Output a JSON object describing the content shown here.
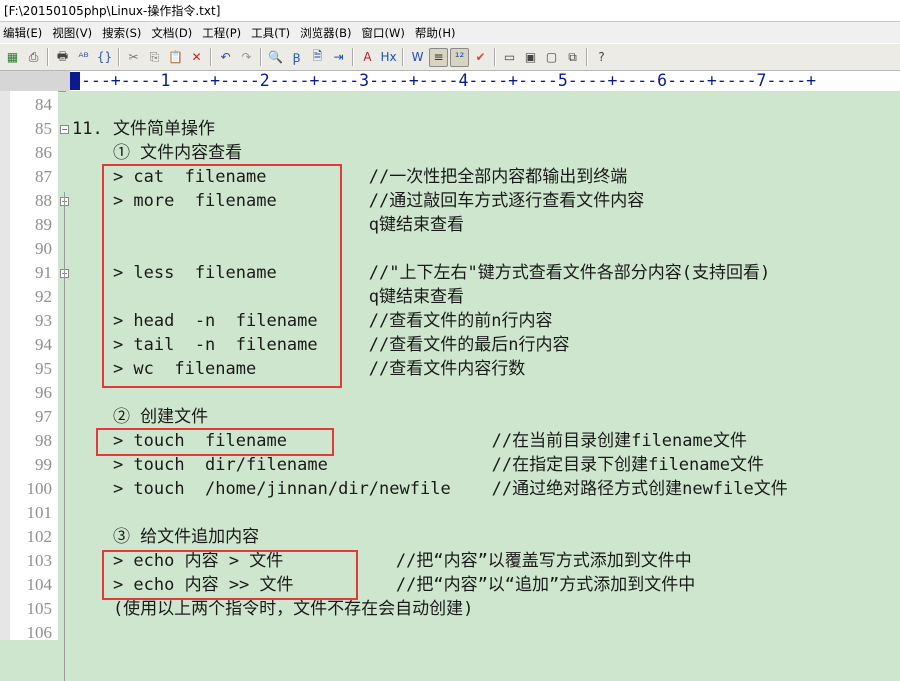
{
  "window": {
    "title": "[F:\\20150105php\\Linux-操作指令.txt]"
  },
  "menu": [
    "编辑(E)",
    "视图(V)",
    "搜索(S)",
    "文档(D)",
    "工程(P)",
    "工具(T)",
    "浏览器(B)",
    "窗口(W)",
    "帮助(H)"
  ],
  "toolbar": {
    "icons": [
      "new-file-icon",
      "print-icon",
      "print-preview-icon",
      "spell-check-icon",
      "bracket-match-icon",
      "cut-icon",
      "copy-icon",
      "paste-icon",
      "delete-icon",
      "undo-icon",
      "redo-icon",
      "find-icon",
      "replace-icon",
      "find-in-files-icon",
      "goto-icon",
      "font-icon",
      "hex-icon",
      "word-wrap-icon",
      "line-number-icon",
      "ruler-toggle-icon",
      "check-icon",
      "view-icon",
      "tile-icon",
      "cascade-icon",
      "window-list-icon",
      "help-pointer-icon"
    ],
    "glyphs": [
      "▦",
      "⎙",
      "🖶",
      "ᴬᴮ",
      "{}",
      "✂",
      "⎘",
      "📋",
      "✕",
      "↶",
      "↷",
      "🔍",
      "Ꞵ",
      "🗎",
      "⇥",
      "A",
      "Hx",
      "W",
      "≡",
      "¹²",
      "✔",
      "▭",
      "▣",
      "▢",
      "⧉",
      "?"
    ]
  },
  "ruler": {
    "marks": "---+----1----+----2----+----3----+----4----+----5----+----6----+----7----+"
  },
  "editor": {
    "lines": [
      {
        "n": "84",
        "text": ""
      },
      {
        "n": "85",
        "text": "11. 文件简单操作"
      },
      {
        "n": "86",
        "text": "    ① 文件内容查看"
      },
      {
        "n": "87",
        "text": "    > cat  filename          //一次性把全部内容都输出到终端"
      },
      {
        "n": "88",
        "text": "    > more  filename         //通过敲回车方式逐行查看文件内容"
      },
      {
        "n": "89",
        "text": "                             q键结束查看"
      },
      {
        "n": "90",
        "text": ""
      },
      {
        "n": "91",
        "text": "    > less  filename         //\"上下左右\"键方式查看文件各部分内容(支持回看)"
      },
      {
        "n": "92",
        "text": "                             q键结束查看"
      },
      {
        "n": "93",
        "text": "    > head  -n  filename     //查看文件的前n行内容"
      },
      {
        "n": "94",
        "text": "    > tail  -n  filename     //查看文件的最后n行内容"
      },
      {
        "n": "95",
        "text": "    > wc  filename           //查看文件内容行数"
      },
      {
        "n": "96",
        "text": ""
      },
      {
        "n": "97",
        "text": "    ② 创建文件"
      },
      {
        "n": "98",
        "text": "    > touch  filename                    //在当前目录创建filename文件"
      },
      {
        "n": "99",
        "text": "    > touch  dir/filename                //在指定目录下创建filename文件"
      },
      {
        "n": "100",
        "text": "    > touch  /home/jinnan/dir/newfile    //通过绝对路径方式创建newfile文件"
      },
      {
        "n": "101",
        "text": ""
      },
      {
        "n": "102",
        "text": "    ③ 给文件追加内容"
      },
      {
        "n": "103",
        "text": "    > echo 内容 > 文件           //把“内容”以覆盖写方式添加到文件中"
      },
      {
        "n": "104",
        "text": "    > echo 内容 >> 文件          //把“内容”以“追加”方式添加到文件中"
      },
      {
        "n": "105",
        "text": "    (使用以上两个指令时，文件不存在会自动创建)"
      },
      {
        "n": "106",
        "text": ""
      }
    ],
    "folds": [
      "85",
      "88",
      "91"
    ]
  },
  "colors": {
    "editor_bg": "#cfe6ce",
    "highlight_box": "#e23a3a",
    "ruler_text": "#0b1a8f",
    "line_number": "#8f8f8f"
  }
}
